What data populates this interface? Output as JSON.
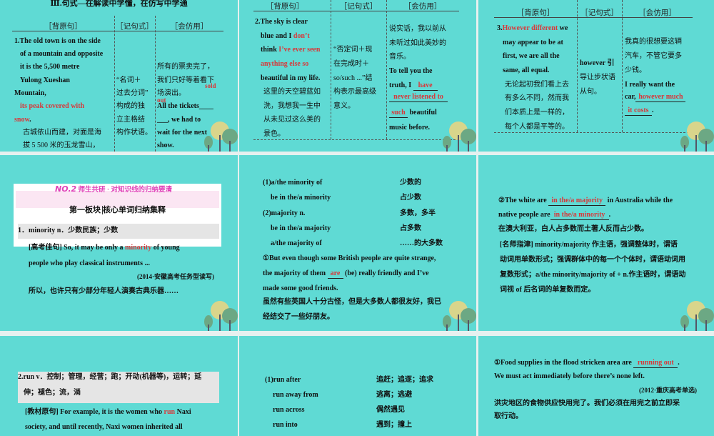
{
  "headers": {
    "c1": "［背原句］",
    "c2": "［记句式］",
    "c3": "［会仿用］"
  },
  "s1": {
    "title": "Ⅲ.句式—在解读中学懂，在仿写中学通",
    "l": [
      "1.The old town is on the side",
      "of a mountain and opposite",
      "it is the 5,500 metre",
      "Yulong Xueshan",
      "Mountain,",
      "its peak covered with",
      "snow",
      ".",
      "古城依山而建，对面是海",
      "拔 5 500 米的玉龙雪山，"
    ],
    "m": [
      "“名词＋",
      "过去分词”",
      "构成的独",
      "立主格结",
      "构作状语。"
    ],
    "p": [
      "所有的票卖完了，",
      "我们只好等着看下",
      "场演出。",
      "All the tickets____",
      "___, we had to",
      "wait for the next",
      "show."
    ],
    "a1": "sold",
    "a2": "out"
  },
  "s2": {
    "l": [
      "2.The sky is clear",
      "blue and I ",
      "don’t",
      "think ",
      "I’ve ever seen",
      "anything else so",
      "beautiful in my life.",
      "这里的天空碧蓝如",
      "洗，我想我一生中",
      "从未见过这么美的",
      "景色。"
    ],
    "m": [
      "“否定词＋现",
      "在完成时＋",
      "so/such ...”结",
      "构表示最高级",
      "意义。"
    ],
    "p": [
      "说实话，我以前从",
      "未听过如此美妙的",
      "音乐。",
      "To tell you the",
      "truth, I ",
      "have",
      "never listened to",
      "such",
      " beautiful",
      "music before."
    ]
  },
  "s3": {
    "l": [
      "3.",
      "However different",
      " we",
      "may appear to be at",
      "first, we are all the",
      "same, all equal.",
      "无论起初我们看上去",
      "有多么不同，然而我",
      "们本质上是一样的，",
      "每个人都是平等的。"
    ],
    "m": [
      "however 引",
      "导让步状语",
      "从句。"
    ],
    "p": [
      "我真的很想要这辆",
      "汽车，不管它要多",
      "少钱。",
      "I really want the",
      "car,",
      "however much",
      "it costs",
      "."
    ]
  },
  "s4": {
    "no": "NO.2",
    "sub": "师生共研 · 对知识线的归纳要清",
    "block": "第一板块",
    "blockt": "核心单词归纳集释",
    "word": "1．minority n．少数民族；少数",
    "l1a": "[高考佳句]  So, it may be only a ",
    "l1b": "minority",
    "l1c": " of young",
    "l2": "people who play classical instruments ...",
    "src": "(2014·安徽高考任务型读写)",
    "cn": "所以，也许只有少部分年轻人演奏古典乐器……"
  },
  "s5": {
    "rows": [
      [
        "(1)a/the minority of",
        "少数的"
      ],
      [
        "be in the/a minority",
        "占少数"
      ],
      [
        "(2)majority n.",
        "多数，多半"
      ],
      [
        "be in the/a majority",
        "占多数"
      ],
      [
        "a/the majority of",
        "……的大多数"
      ]
    ],
    "e1": "①But even though some British people are quite strange,",
    "e2a": "the majority of them ",
    "ans": "are",
    "e2b": " (be) really friendly and I’ve",
    "e3": "made some good friends.",
    "c1": "虽然有些英国人十分古怪，但是大多数人都很友好，我已",
    "c2": "经结交了一些好朋友。"
  },
  "s6": {
    "a": "②The white are ",
    "ans1": "in the/a majority",
    "b": " in Australia while the",
    "c": "native people are",
    "ans2": "in the/a minority",
    "d": ".",
    "cn": "在澳大利亚，白人占多数而土著人反而占少数。",
    "t": [
      "[名师指津]  minority/majority 作主语，强调整体时，谓语",
      "动词用单数形式；强调群体中的每一个个体时，谓语动词用",
      "复数形式；a/the minority/majority of + n.作主语时，谓语动",
      "词视 of 后名词的单复数而定。"
    ]
  },
  "s7": {
    "w1": "2.run v．控制；管理，经营；跑；开动(机器等)，运转；延",
    "w2": "伸；褪色；流，淌",
    "l1a": "[教材原句]  For example, it is the women who ",
    "l1b": "run",
    "l1c": " Naxi",
    "l2": "society, and until recently, Naxi women inherited all"
  },
  "s8": {
    "rows": [
      [
        "(1)run after",
        "追赶；追逐；追求"
      ],
      [
        "run away from",
        "逃离；逃避"
      ],
      [
        "run across",
        "偶然遇见"
      ],
      [
        "run into",
        "遇到；撞上"
      ]
    ]
  },
  "s9": {
    "a": "①Food supplies in the flood stricken area are ",
    "ans": "running out",
    "b": ".",
    "l2": "We must act immediately before there’s none left.",
    "src": "(2012·重庆高考单选)",
    "c1": "洪灾地区的食物供应快用完了。我们必须在用完之前立即采",
    "c2": "取行动。"
  }
}
